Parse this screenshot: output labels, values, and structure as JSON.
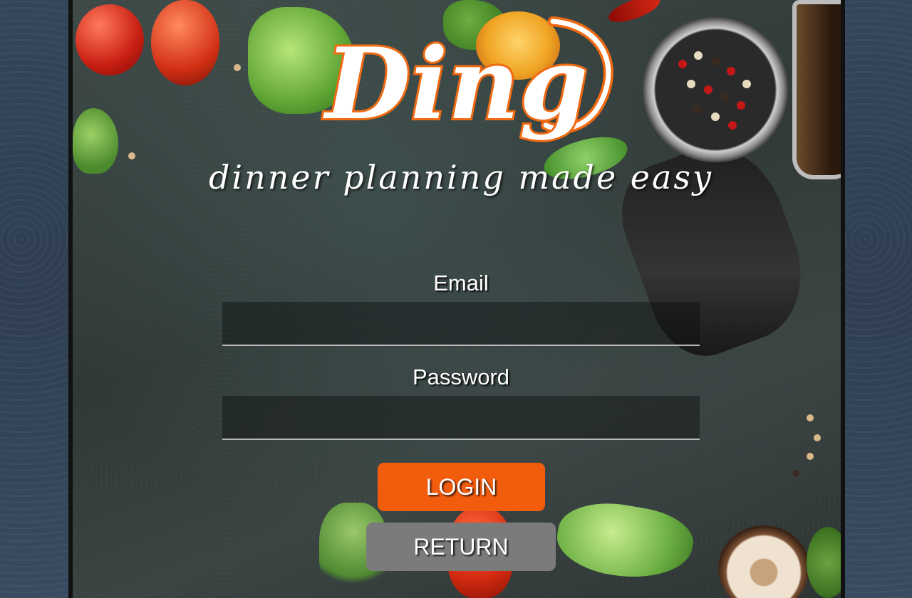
{
  "app": {
    "logo_text": "Ding",
    "tagline": "dinner planning made easy"
  },
  "form": {
    "email_label": "Email",
    "email_value": "",
    "password_label": "Password",
    "password_value": ""
  },
  "buttons": {
    "login_label": "LOGIN",
    "return_label": "RETURN"
  },
  "colors": {
    "accent": "#f25c0d",
    "secondary_button": "#7b7b7b",
    "logo_outline": "#f06a12"
  },
  "icons": [
    "logo-icon"
  ]
}
